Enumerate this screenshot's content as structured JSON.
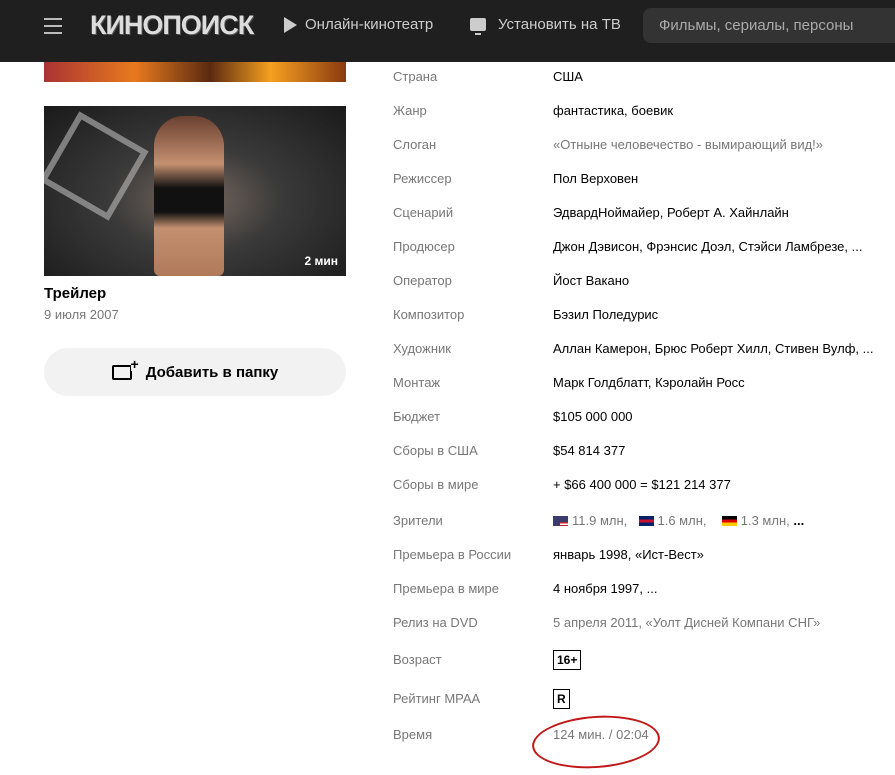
{
  "header": {
    "logo": "КИНОПОИСК",
    "nav": [
      {
        "label": "Онлайн-кинотеатр",
        "icon": "play-icon"
      },
      {
        "label": "Установить на ТВ",
        "icon": "tv-icon"
      }
    ],
    "search_placeholder": "Фильмы, сериалы, персоны"
  },
  "trailer": {
    "duration": "2 мин",
    "title": "Трейлер",
    "date": "9 июля 2007"
  },
  "add_button": "Добавить в папку",
  "details": [
    {
      "label": "Страна",
      "value": "США"
    },
    {
      "label": "Жанр",
      "value": "фантастика, боевик"
    },
    {
      "label": "Слоган",
      "value": "«Отныне человечество - вымирающий вид!»",
      "muted": true
    },
    {
      "label": "Режиссер",
      "value": "Пол Верховен"
    },
    {
      "label": "Сценарий",
      "value": "ЭдвардНоймайер, Роберт А. Хайнлайн"
    },
    {
      "label": "Продюсер",
      "value": "Джон Дэвисон, Фрэнсис Доэл, Стэйси Ламбрезе, ..."
    },
    {
      "label": "Оператор",
      "value": "Йост Вакано"
    },
    {
      "label": "Композитор",
      "value": "Бэзил Поледурис"
    },
    {
      "label": "Художник",
      "value": "Аллан Камерон, Брюс Роберт Хилл, Стивен Вулф, ..."
    },
    {
      "label": "Монтаж",
      "value": "Марк Голдблатт, Кэролайн Росс"
    },
    {
      "label": "Бюджет",
      "value": "$105 000 000"
    },
    {
      "label": "Сборы в США",
      "value": "$54 814 377"
    },
    {
      "label": "Сборы в мире",
      "value": "+ $66 400 000 = $121 214 377"
    }
  ],
  "viewers": {
    "label": "Зрители",
    "items": [
      {
        "flag": "us-flag-icon",
        "value": "11.9 млн,"
      },
      {
        "flag": "uk-flag-icon",
        "value": "1.6 млн,"
      },
      {
        "flag": "de-flag-icon",
        "value": "1.3 млн,"
      }
    ],
    "more": "..."
  },
  "details2": [
    {
      "label": "Премьера в России",
      "value": "январь 1998, «Ист-Вест»"
    },
    {
      "label": "Премьера в мире",
      "value": "4 ноября 1997, ..."
    },
    {
      "label": "Релиз на DVD",
      "value": "5 апреля 2011, «Уолт Дисней Компани СНГ»",
      "muted": true
    }
  ],
  "age": {
    "label": "Возраст",
    "value": "16+"
  },
  "mpaa": {
    "label": "Рейтинг MPAA",
    "value": "R"
  },
  "time": {
    "label": "Время",
    "value": "124 мин. / 02:04"
  }
}
